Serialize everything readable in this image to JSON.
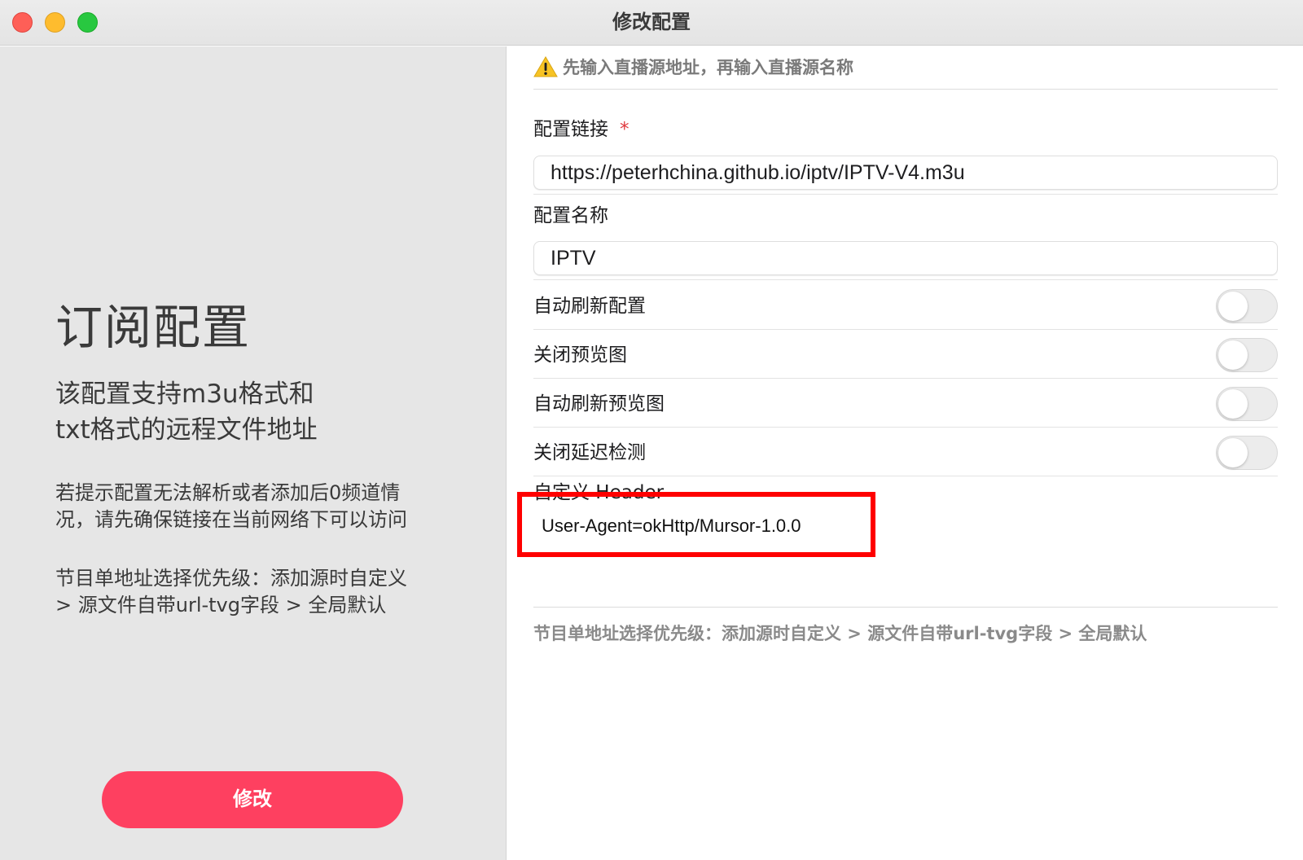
{
  "window": {
    "title": "修改配置"
  },
  "left": {
    "heading": "订阅配置",
    "subheading_line1": "该配置支持m3u格式和",
    "subheading_line2": "txt格式的远程文件地址",
    "note1_line1": "若提示配置无法解析或者添加后0频道情",
    "note1_line2": "况，请先确保链接在当前网络下可以访问",
    "note2_line1": "节目单地址选择优先级：添加源时自定义",
    "note2_line2": "> 源文件自带url-tvg字段 > 全局默认",
    "submit_label": "修改"
  },
  "form": {
    "warning": "先输入直播源地址，再输入直播源名称",
    "url_label": "配置链接",
    "required_mark": "*",
    "url_value": "https://peterhchina.github.io/iptv/IPTV-V4.m3u",
    "name_label": "配置名称",
    "name_value": "IPTV",
    "toggles": [
      {
        "label": "自动刷新配置",
        "on": false
      },
      {
        "label": "关闭预览图",
        "on": false
      },
      {
        "label": "自动刷新预览图",
        "on": false
      },
      {
        "label": "关闭延迟检测",
        "on": false
      }
    ],
    "header_label": "自定义 Header",
    "header_value": "User-Agent=okHttp/Mursor-1.0.0",
    "footnote": "节目单地址选择优先级：添加源时自定义 > 源文件自带url-tvg字段 > 全局默认"
  },
  "colors": {
    "accent": "#fe4060",
    "highlight": "#ff0000",
    "required": "#e0393e"
  },
  "icons": {
    "warning": "warning-icon"
  }
}
